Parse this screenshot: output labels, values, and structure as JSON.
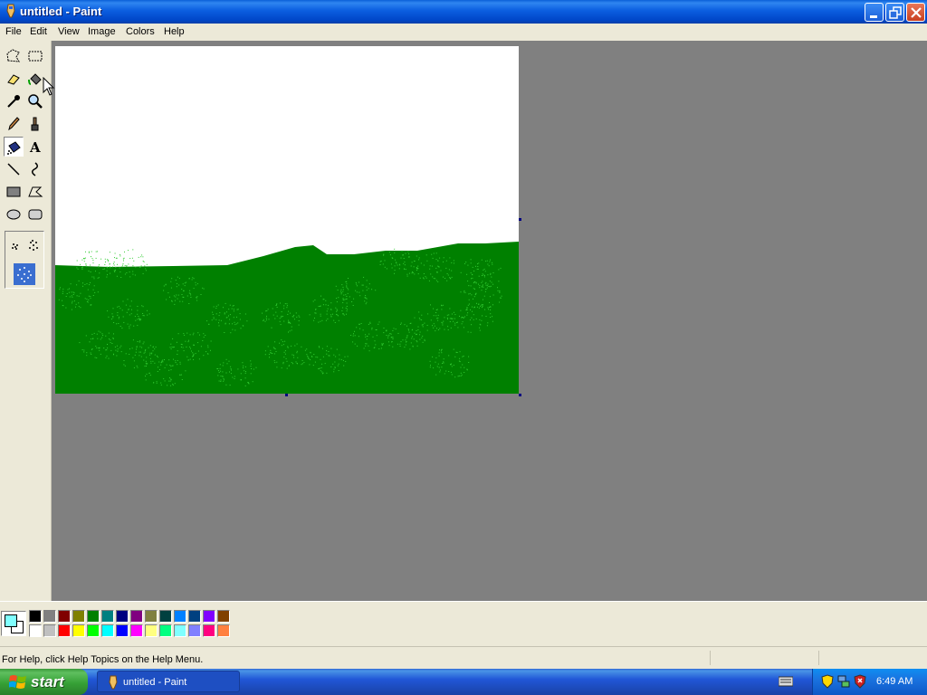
{
  "window": {
    "title": "untitled - Paint",
    "colors": {
      "titlebar": "#0b5ee0",
      "menubar": "#ece9d8",
      "workspace": "#808080"
    }
  },
  "menu": {
    "items": [
      "File",
      "Edit",
      "View",
      "Image",
      "Colors",
      "Help"
    ]
  },
  "tools": [
    {
      "name": "free-form-select-icon"
    },
    {
      "name": "select-icon"
    },
    {
      "name": "eraser-icon"
    },
    {
      "name": "fill-with-color-icon"
    },
    {
      "name": "pick-color-icon"
    },
    {
      "name": "magnifier-icon"
    },
    {
      "name": "pencil-icon"
    },
    {
      "name": "brush-icon"
    },
    {
      "name": "airbrush-icon",
      "active": true
    },
    {
      "name": "text-icon",
      "glyph": "A"
    },
    {
      "name": "line-icon"
    },
    {
      "name": "curve-icon"
    },
    {
      "name": "rectangle-icon"
    },
    {
      "name": "polygon-icon"
    },
    {
      "name": "ellipse-icon"
    },
    {
      "name": "rounded-rectangle-icon"
    }
  ],
  "canvas": {
    "background": "#ffffff",
    "grass_color": "#008000",
    "spray_color": "#33cc33"
  },
  "palette": {
    "foreground": "#80ffff",
    "background": "#ffffff",
    "top_row": [
      "#000000",
      "#808080",
      "#800000",
      "#808000",
      "#008000",
      "#008080",
      "#000080",
      "#800080",
      "#808040",
      "#004040",
      "#0080ff",
      "#004080",
      "#8000ff",
      "#804000"
    ],
    "bottom_row": [
      "#ffffff",
      "#c0c0c0",
      "#ff0000",
      "#ffff00",
      "#00ff00",
      "#00ffff",
      "#0000ff",
      "#ff00ff",
      "#ffff80",
      "#00ff80",
      "#80ffff",
      "#8080ff",
      "#ff0080",
      "#ff8040"
    ]
  },
  "statusbar": {
    "text": "For Help, click Help Topics on the Help Menu."
  },
  "taskbar": {
    "start_label": "start",
    "task_label": "untitled - Paint",
    "clock": "6:49 AM"
  }
}
